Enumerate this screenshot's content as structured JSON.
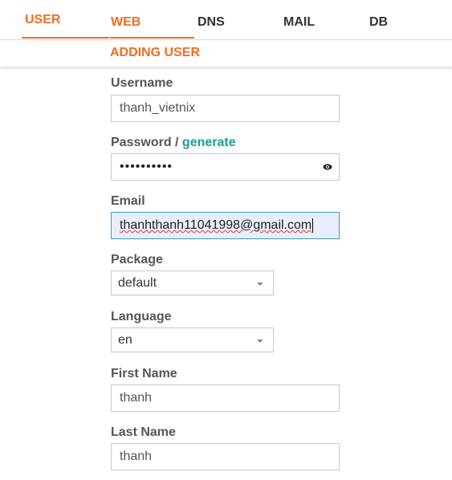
{
  "nav": {
    "items": [
      {
        "label": "USER"
      },
      {
        "label": "WEB"
      },
      {
        "label": "DNS"
      },
      {
        "label": "MAIL"
      },
      {
        "label": "DB"
      }
    ]
  },
  "page": {
    "title": "ADDING USER"
  },
  "form": {
    "username": {
      "label": "Username",
      "value": "thanh_vietnix"
    },
    "password": {
      "label": "Password / ",
      "generate": "generate",
      "value": "••••••••••",
      "icon": "eye-icon"
    },
    "email": {
      "label": "Email",
      "value": "thanhthanh11041998@gmail.com"
    },
    "package": {
      "label": "Package",
      "value": "default"
    },
    "language": {
      "label": "Language",
      "value": "en"
    },
    "first_name": {
      "label": "First Name",
      "value": "thanh"
    },
    "last_name": {
      "label": "Last Name",
      "value": "thanh"
    }
  },
  "colors": {
    "accent": "#f26c22",
    "link": "#1a9d96",
    "focus_bg": "#e8eefc",
    "focus_border": "#3a9fb0"
  }
}
